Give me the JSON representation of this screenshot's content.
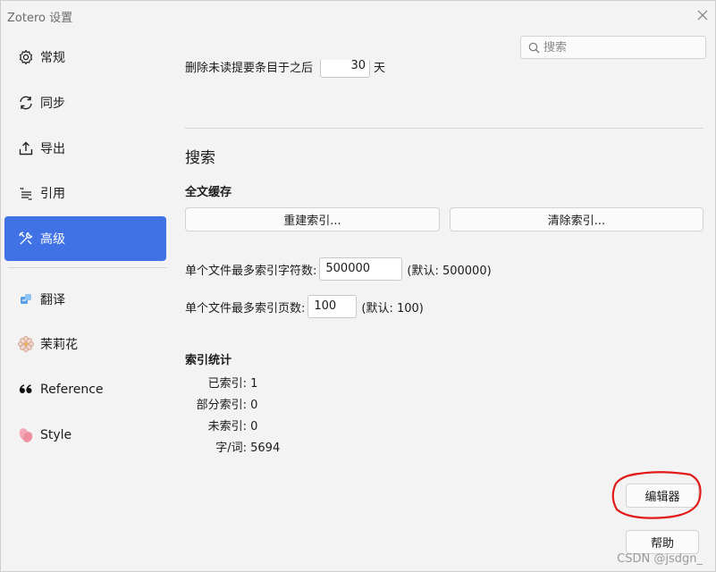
{
  "window": {
    "title": "Zotero 设置"
  },
  "sidebar": {
    "items": [
      {
        "label": "常规",
        "icon": "gear-icon"
      },
      {
        "label": "同步",
        "icon": "sync-icon"
      },
      {
        "label": "导出",
        "icon": "export-icon"
      },
      {
        "label": "引用",
        "icon": "cite-icon"
      },
      {
        "label": "高级",
        "icon": "tools-icon",
        "active": true
      },
      {
        "label": "翻译",
        "icon": "translate-icon"
      },
      {
        "label": "茉莉花",
        "icon": "jasmine-icon"
      },
      {
        "label": "Reference",
        "icon": "quote-icon"
      },
      {
        "label": "Style",
        "icon": "petal-icon"
      }
    ],
    "active_color": "#4072e5"
  },
  "search": {
    "placeholder": "搜索"
  },
  "main": {
    "clipped_row": {
      "label": "删除未读提要条目于之后",
      "value": "30",
      "unit": "天"
    },
    "section_title": "搜索",
    "fulltext_title": "全文缓存",
    "rebuild_label": "重建索引...",
    "clear_label": "清除索引...",
    "max_chars": {
      "label": "单个文件最多索引字符数:",
      "value": "500000",
      "default": "(默认: 500000)"
    },
    "max_pages": {
      "label": "单个文件最多索引页数:",
      "value": "100",
      "default": "(默认: 100)"
    },
    "stats_title": "索引统计",
    "stats": [
      {
        "label": "已索引:",
        "value": "1"
      },
      {
        "label": "部分索引:",
        "value": "0"
      },
      {
        "label": "未索引:",
        "value": "0"
      },
      {
        "label": "字/词:",
        "value": "5694"
      }
    ],
    "editor_label": "编辑器",
    "help_label": "帮助"
  },
  "watermark": "CSDN @jsdgn_"
}
